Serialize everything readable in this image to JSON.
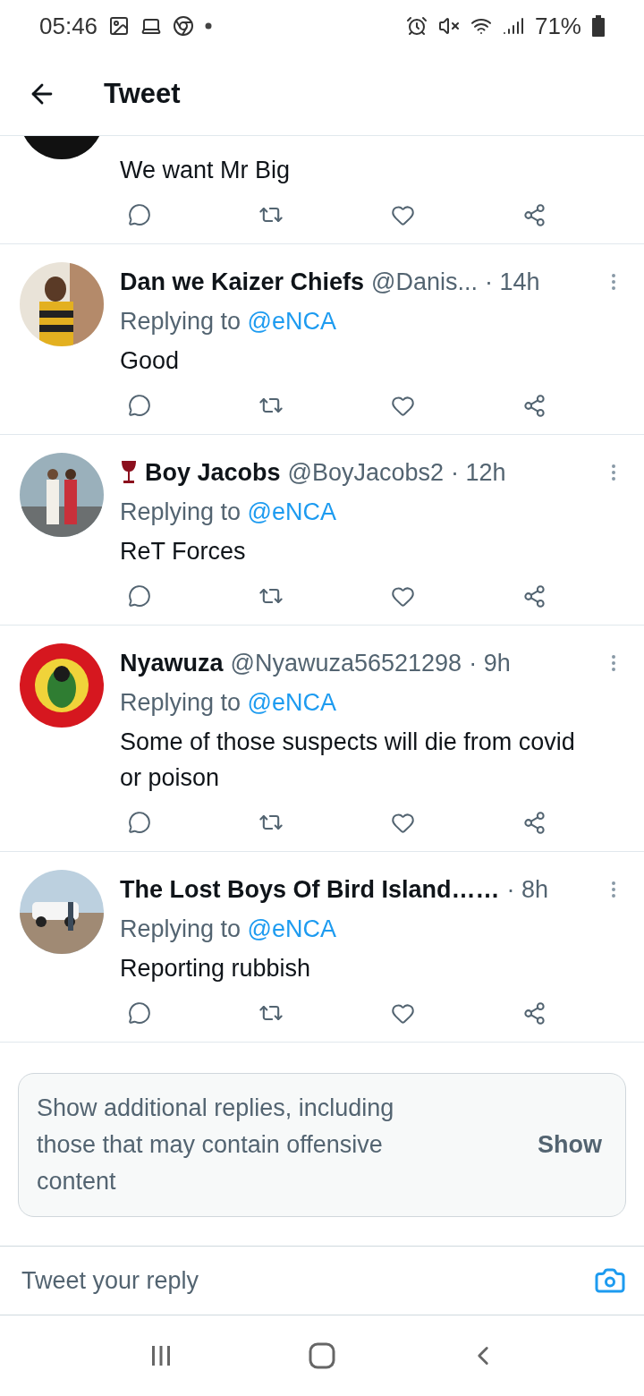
{
  "status_bar": {
    "time": "05:46",
    "battery": "71%"
  },
  "header": {
    "title": "Tweet"
  },
  "tweets": [
    {
      "body": "We want Mr Big"
    },
    {
      "display_name": "Dan we Kaizer Chiefs",
      "handle": "@Danis...",
      "time": "· 14h",
      "replying_prefix": "Replying to",
      "replying_to": "@eNCA",
      "body": "Good"
    },
    {
      "wine_glass_icon": true,
      "display_name": "Boy Jacobs",
      "handle": "@BoyJacobs2",
      "time": "· 12h",
      "replying_prefix": "Replying to",
      "replying_to": "@eNCA",
      "body": "ReT Forces"
    },
    {
      "display_name": "Nyawuza",
      "handle": "@Nyawuza56521298",
      "time": "· 9h",
      "replying_prefix": "Replying to",
      "replying_to": "@eNCA",
      "body": "Some of those suspects will die from covid or poison"
    },
    {
      "display_name": "The Lost Boys Of Bird Island……",
      "time": "· 8h",
      "replying_prefix": "Replying to",
      "replying_to": "@eNCA",
      "body": "Reporting rubbish"
    }
  ],
  "more_replies": {
    "text": "Show additional replies, including those that may contain offensive content",
    "button": "Show"
  },
  "reply_bar": {
    "placeholder": "Tweet your reply"
  }
}
